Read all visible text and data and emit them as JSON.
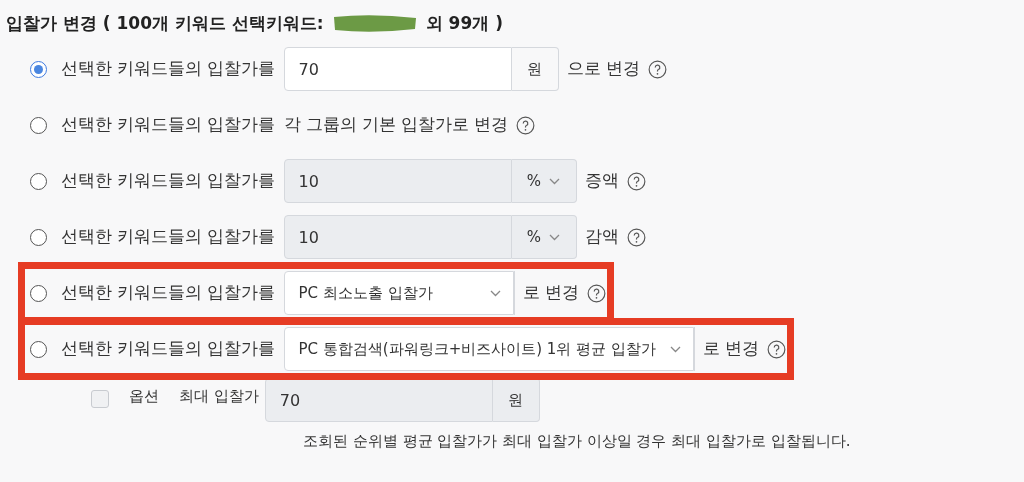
{
  "title": {
    "before": "입찰가 변경 ( 100개 키워드 선택키워드:",
    "after": "외 99개 )",
    "redacted": true
  },
  "options": [
    {
      "kind": "input",
      "selected": true,
      "highlighted": false,
      "label": "선택한 키워드들의 입찰가를",
      "value": "70",
      "unit": "원",
      "disabled": false,
      "suffix": "으로 변경"
    },
    {
      "kind": "text",
      "selected": false,
      "highlighted": false,
      "label": "선택한 키워드들의 입찰가를",
      "text": "각 그룹의 기본 입찰가로 변경"
    },
    {
      "kind": "select_unit",
      "selected": false,
      "highlighted": false,
      "label": "선택한 키워드들의 입찰가를",
      "value": "10",
      "unit": "%",
      "disabled": true,
      "suffix": "증액"
    },
    {
      "kind": "select_unit",
      "selected": false,
      "highlighted": false,
      "label": "선택한 키워드들의 입찰가를",
      "value": "10",
      "unit": "%",
      "disabled": true,
      "suffix": "감액"
    },
    {
      "kind": "select",
      "selected": false,
      "highlighted": true,
      "label": "선택한 키워드들의 입찰가를",
      "value": "PC 최소노출 입찰가",
      "suffix": "로 변경"
    },
    {
      "kind": "select",
      "selected": false,
      "highlighted": true,
      "label": "선택한 키워드들의 입찰가를",
      "value": "PC 통합검색(파워링크+비즈사이트) 1위 평균 입찰가",
      "suffix": "로 변경"
    }
  ],
  "max_bid": {
    "checked": false,
    "checkbox_label": "옵션",
    "label": "최대 입찰가",
    "value": "70",
    "unit": "원",
    "disabled": true,
    "note": "조회된 순위별 평균 입찰가가 최대 입찰가 이상일 경우 최대 입찰가로 입찰됩니다."
  }
}
